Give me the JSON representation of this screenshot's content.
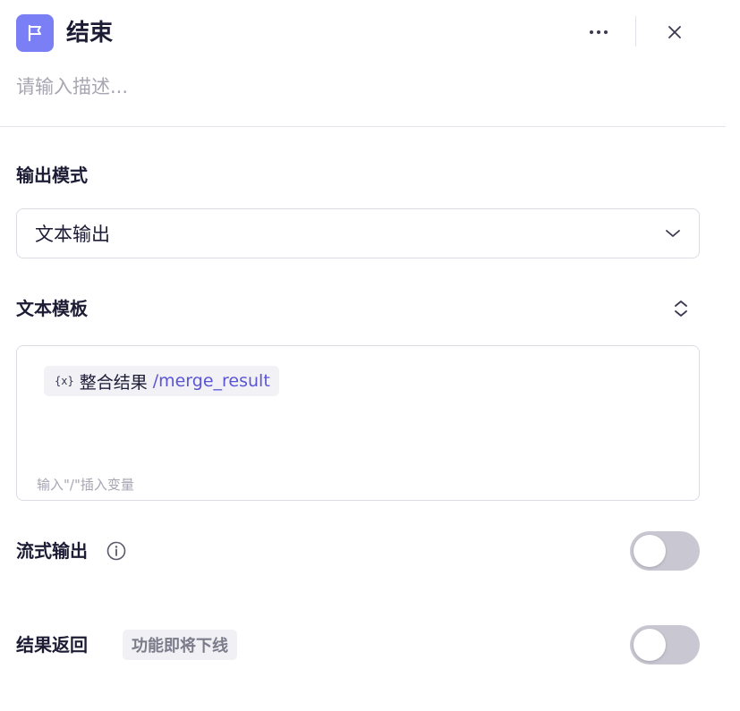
{
  "header": {
    "title": "结束",
    "description_placeholder": "请输入描述...",
    "description_value": ""
  },
  "output_mode": {
    "label": "输出模式",
    "selected": "文本输出"
  },
  "text_template": {
    "label": "文本模板",
    "variable": {
      "icon_text": "{x}",
      "name": "整合结果",
      "path": "/merge_result"
    },
    "hint": "输入\"/\"插入变量"
  },
  "streaming_output": {
    "label": "流式输出",
    "enabled": false
  },
  "result_return": {
    "label": "结果返回",
    "badge": "功能即将下线",
    "enabled": false
  },
  "colors": {
    "node_icon_bg": "#7b7ff5",
    "variable_path": "#5b55d6",
    "toggle_off": "#c9c8d2"
  },
  "icons": {
    "node": "flag-icon",
    "more": "more-horizontal-icon",
    "close": "close-icon",
    "select": "chevron-down-icon",
    "expand": "chevron-up-down-icon",
    "info": "info-icon"
  }
}
